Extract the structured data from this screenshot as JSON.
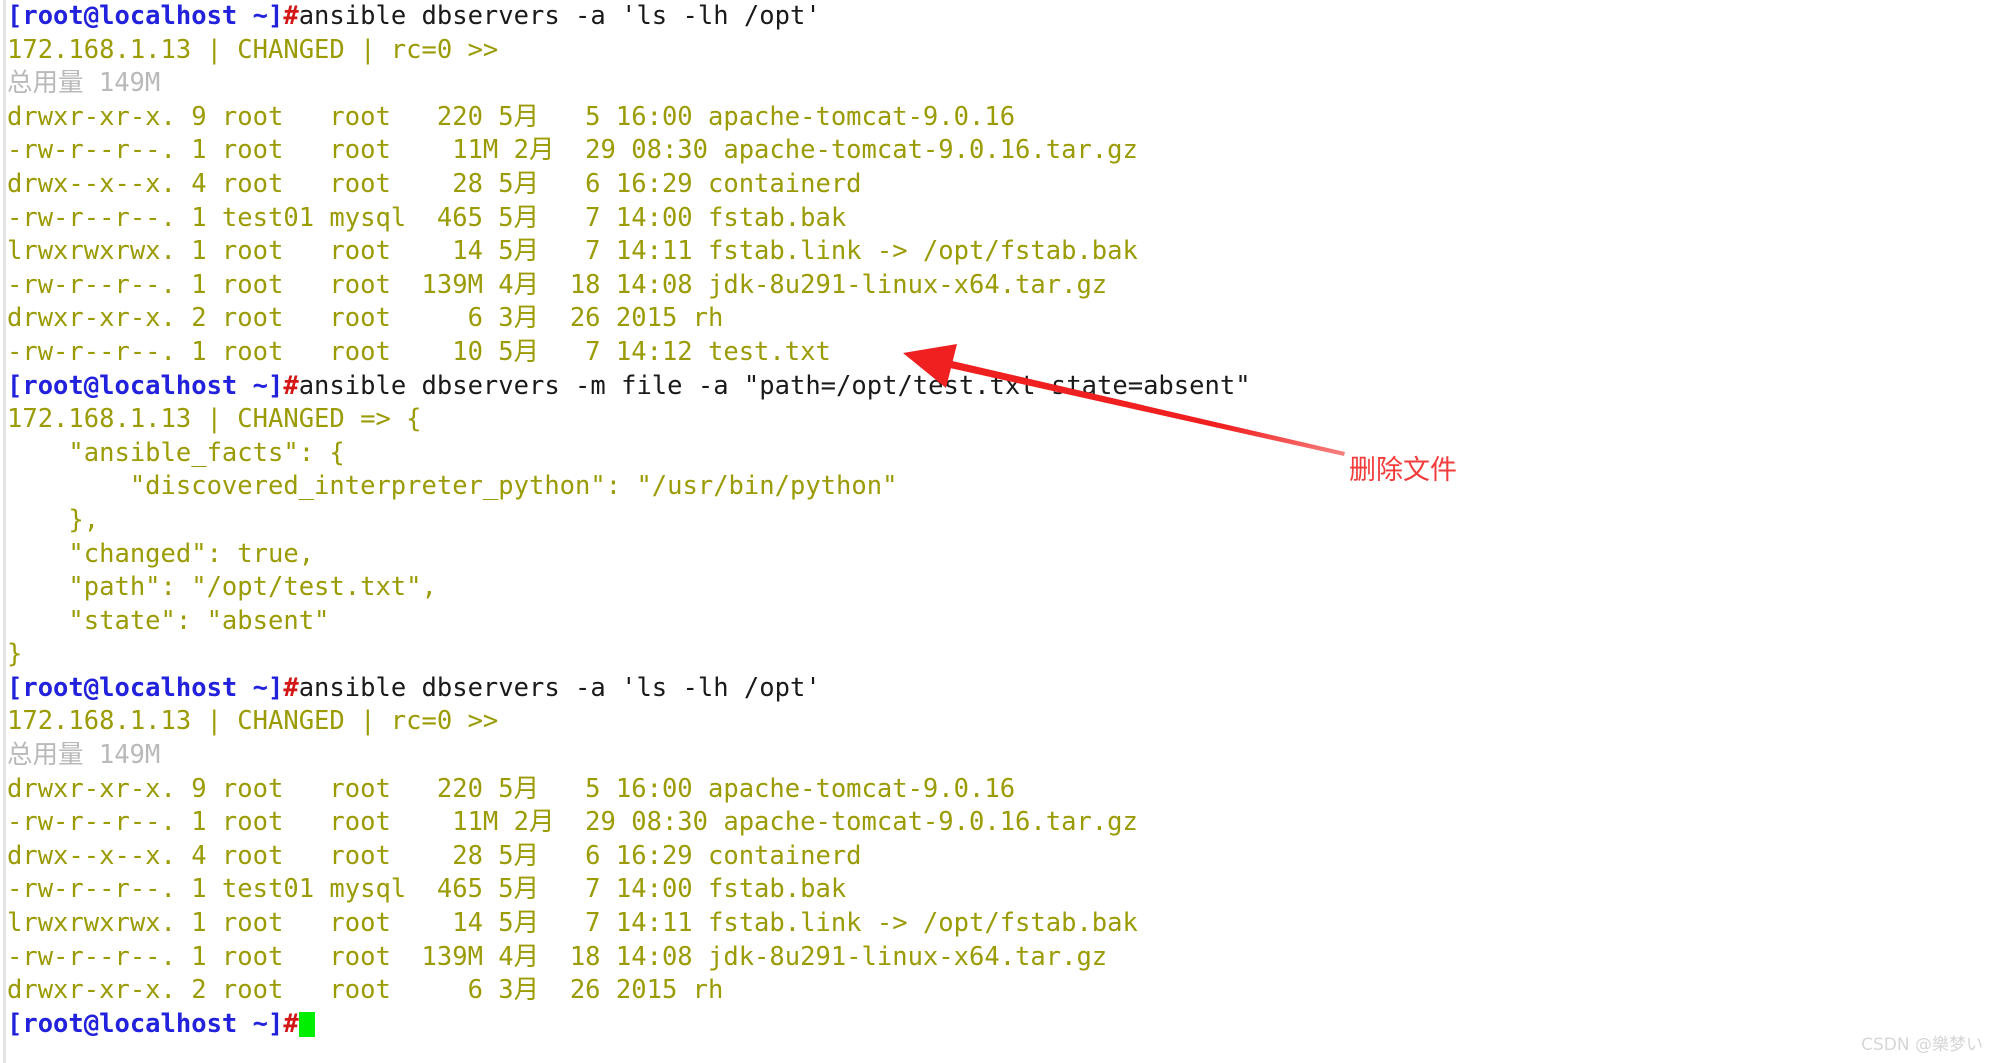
{
  "terminal": {
    "prompt_user_host": "[root@localhost ~]",
    "prompt_symbol": "#",
    "cursor_color": "#00ee00",
    "colors": {
      "output": "#9b9b06",
      "command": "#1a1a1a",
      "prompt": "#2222dd",
      "prompt_hash": "#d41616",
      "dim": "#b9b9b9",
      "annotation": "#f33b3b",
      "background": "#ffffff"
    },
    "lines": [
      {
        "type": "prompt",
        "command": "ansible dbservers -a 'ls -lh /opt'"
      },
      {
        "type": "out",
        "text": "172.168.1.13 | CHANGED | rc=0 >>"
      },
      {
        "type": "dim",
        "text": "总用量 149M"
      },
      {
        "type": "out",
        "text": "drwxr-xr-x. 9 root   root   220 5月   5 16:00 apache-tomcat-9.0.16"
      },
      {
        "type": "out",
        "text": "-rw-r--r--. 1 root   root    11M 2月  29 08:30 apache-tomcat-9.0.16.tar.gz"
      },
      {
        "type": "out",
        "text": "drwx--x--x. 4 root   root    28 5月   6 16:29 containerd"
      },
      {
        "type": "out",
        "text": "-rw-r--r--. 1 test01 mysql  465 5月   7 14:00 fstab.bak"
      },
      {
        "type": "out",
        "text": "lrwxrwxrwx. 1 root   root    14 5月   7 14:11 fstab.link -> /opt/fstab.bak"
      },
      {
        "type": "out",
        "text": "-rw-r--r--. 1 root   root  139M 4月  18 14:08 jdk-8u291-linux-x64.tar.gz"
      },
      {
        "type": "out",
        "text": "drwxr-xr-x. 2 root   root     6 3月  26 2015 rh"
      },
      {
        "type": "out",
        "text": "-rw-r--r--. 1 root   root    10 5月   7 14:12 test.txt"
      },
      {
        "type": "prompt",
        "command": "ansible dbservers -m file -a \"path=/opt/test.txt state=absent\""
      },
      {
        "type": "out",
        "text": "172.168.1.13 | CHANGED => {"
      },
      {
        "type": "out",
        "text": "    \"ansible_facts\": {"
      },
      {
        "type": "out",
        "text": "        \"discovered_interpreter_python\": \"/usr/bin/python\""
      },
      {
        "type": "out",
        "text": "    },"
      },
      {
        "type": "out",
        "text": "    \"changed\": true,"
      },
      {
        "type": "out",
        "text": "    \"path\": \"/opt/test.txt\","
      },
      {
        "type": "out",
        "text": "    \"state\": \"absent\""
      },
      {
        "type": "out",
        "text": "}"
      },
      {
        "type": "prompt",
        "command": "ansible dbservers -a 'ls -lh /opt'"
      },
      {
        "type": "out",
        "text": "172.168.1.13 | CHANGED | rc=0 >>"
      },
      {
        "type": "dim",
        "text": "总用量 149M"
      },
      {
        "type": "out",
        "text": "drwxr-xr-x. 9 root   root   220 5月   5 16:00 apache-tomcat-9.0.16"
      },
      {
        "type": "out",
        "text": "-rw-r--r--. 1 root   root    11M 2月  29 08:30 apache-tomcat-9.0.16.tar.gz"
      },
      {
        "type": "out",
        "text": "drwx--x--x. 4 root   root    28 5月   6 16:29 containerd"
      },
      {
        "type": "out",
        "text": "-rw-r--r--. 1 test01 mysql  465 5月   7 14:00 fstab.bak"
      },
      {
        "type": "out",
        "text": "lrwxrwxrwx. 1 root   root    14 5月   7 14:11 fstab.link -> /opt/fstab.bak"
      },
      {
        "type": "out",
        "text": "-rw-r--r--. 1 root   root  139M 4月  18 14:08 jdk-8u291-linux-x64.tar.gz"
      },
      {
        "type": "out",
        "text": "drwxr-xr-x. 2 root   root     6 3月  26 2015 rh"
      },
      {
        "type": "prompt_cursor",
        "command": ""
      }
    ]
  },
  "annotation": {
    "label": "删除文件",
    "color": "#f33b3b"
  },
  "watermark": {
    "text": "CSDN @樂梦い"
  }
}
